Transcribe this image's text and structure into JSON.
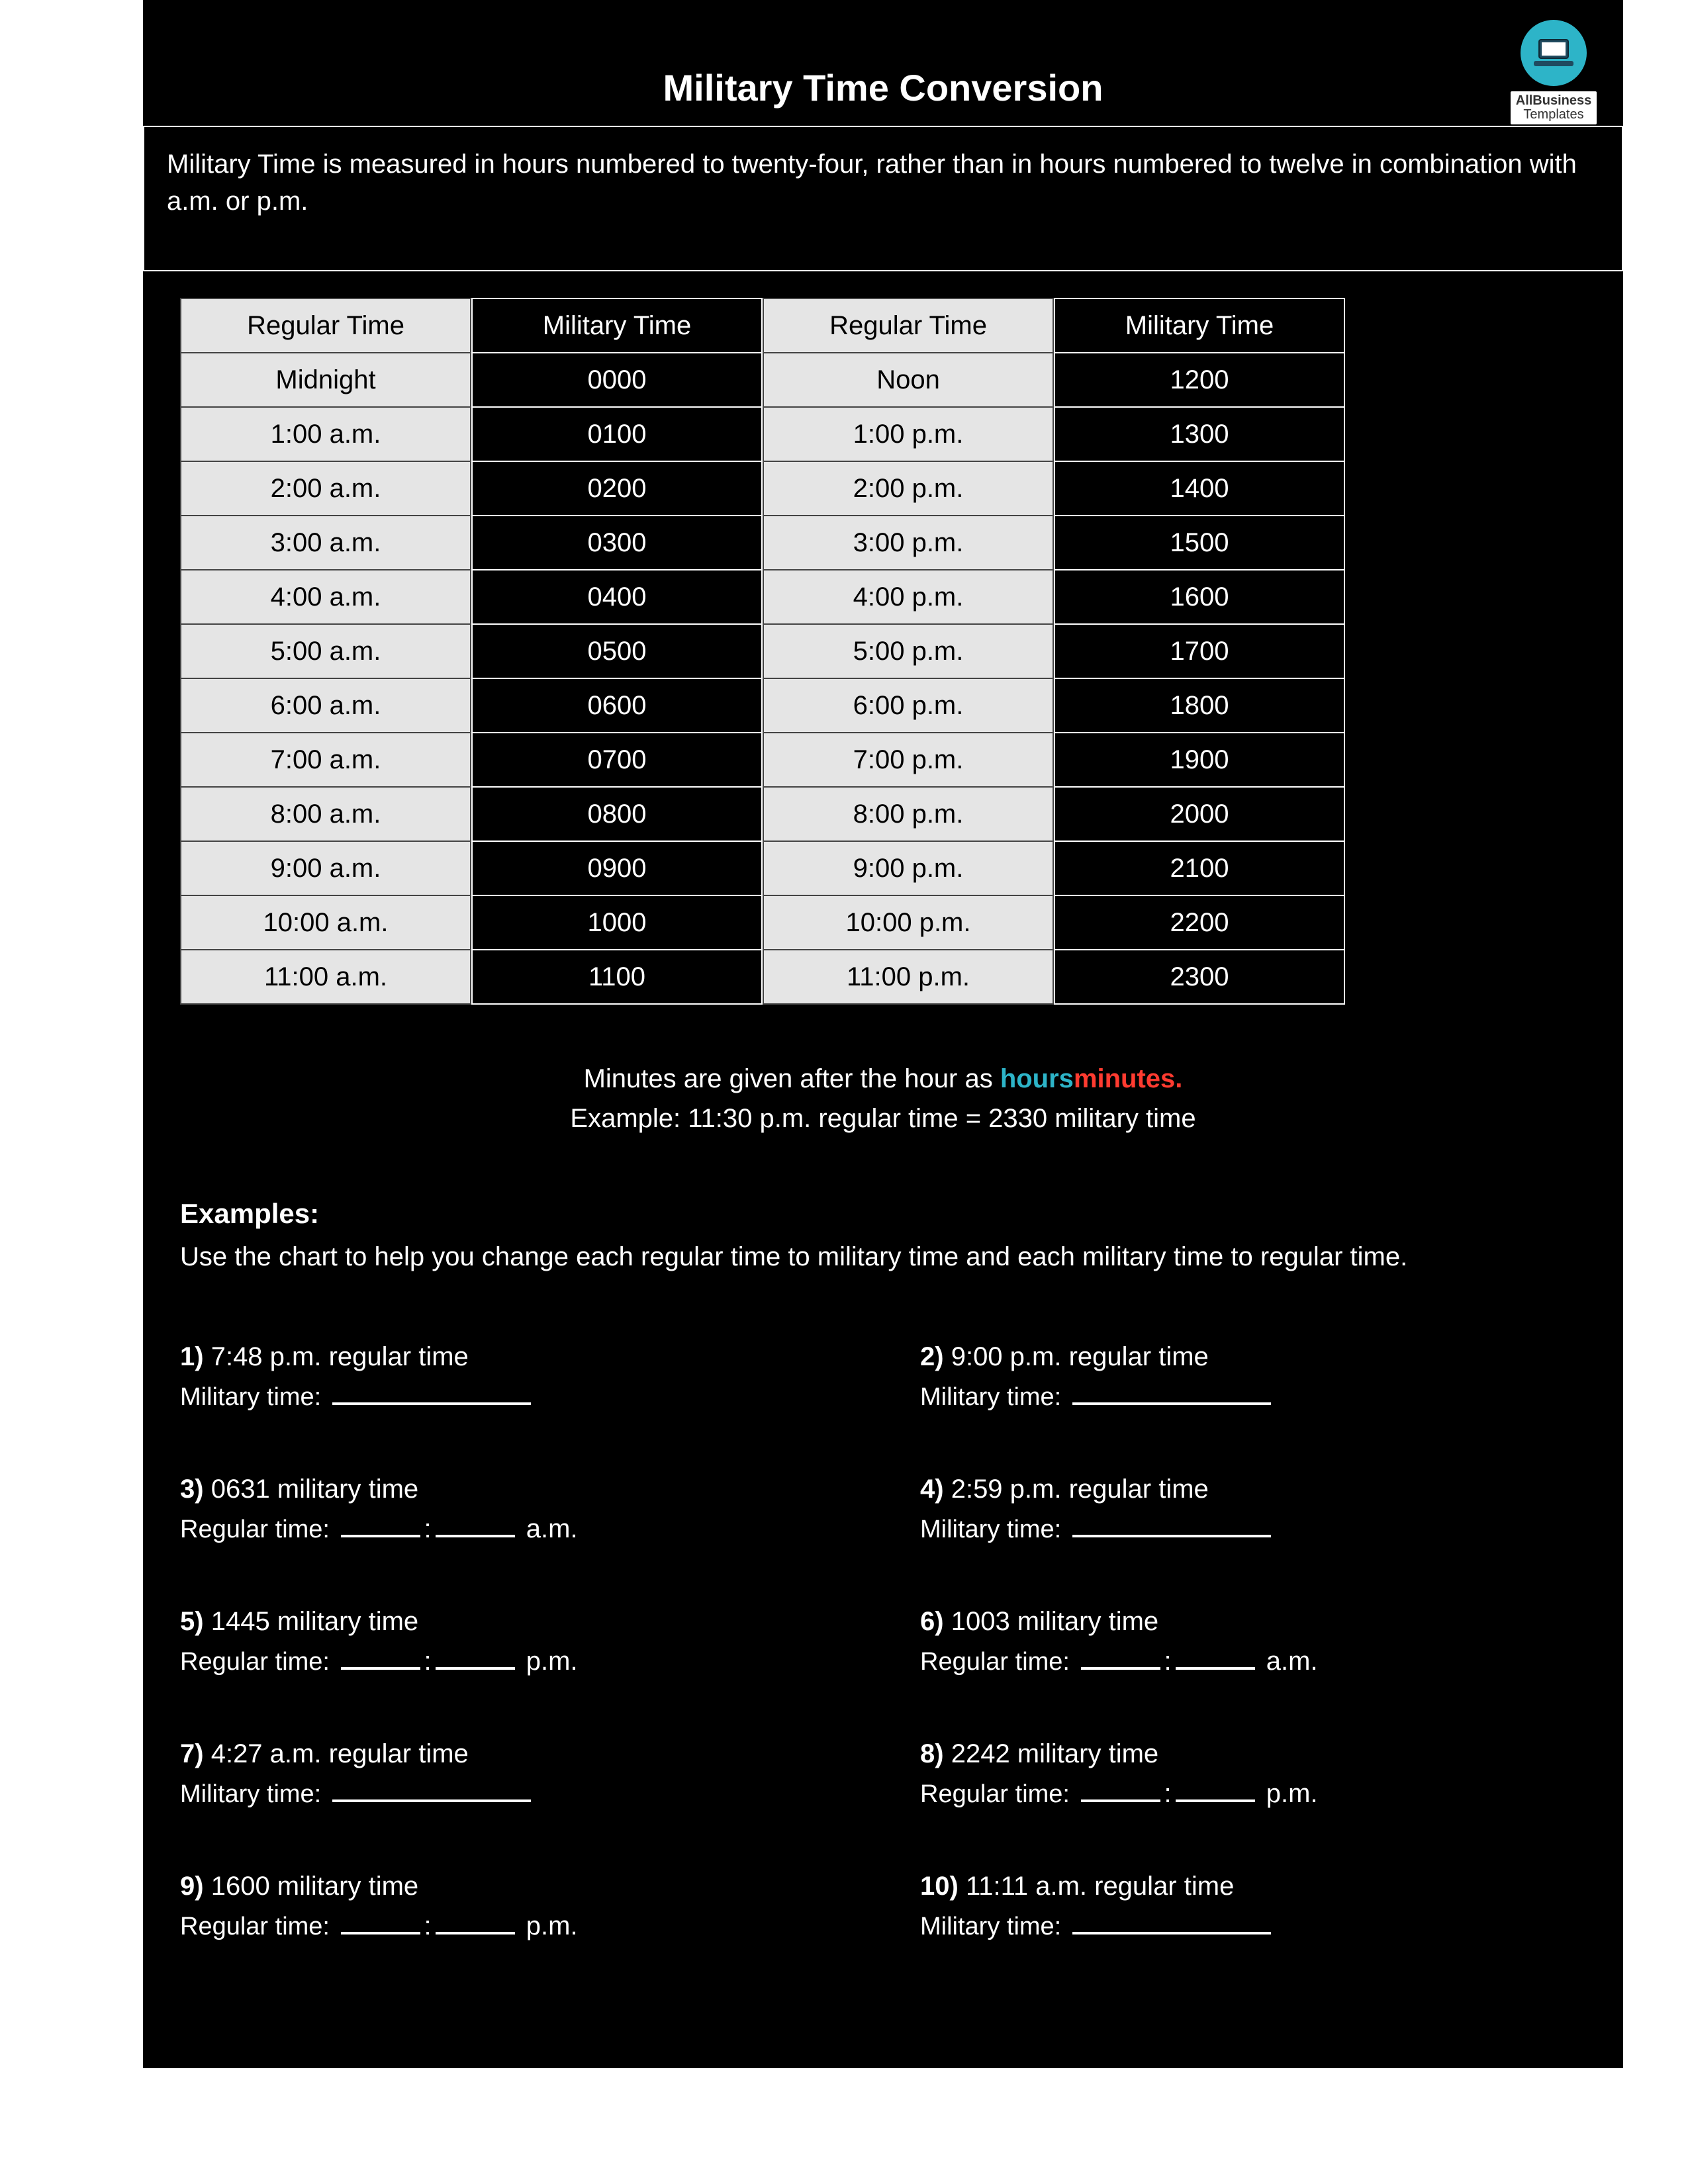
{
  "badge": {
    "line1": "AllBusiness",
    "line2": "Templates"
  },
  "title": "Military Time Conversion",
  "intro": "Military Time is measured in hours numbered to twenty-four, rather than in hours numbered to twelve in combination with a.m. or p.m.",
  "tables": {
    "left": {
      "regular_header": "Regular Time",
      "military_header": "Military Time",
      "rows": [
        {
          "reg": "Midnight",
          "mil": "0000"
        },
        {
          "reg": "1:00 a.m.",
          "mil": "0100"
        },
        {
          "reg": "2:00 a.m.",
          "mil": "0200"
        },
        {
          "reg": "3:00 a.m.",
          "mil": "0300"
        },
        {
          "reg": "4:00 a.m.",
          "mil": "0400"
        },
        {
          "reg": "5:00 a.m.",
          "mil": "0500"
        },
        {
          "reg": "6:00 a.m.",
          "mil": "0600"
        },
        {
          "reg": "7:00 a.m.",
          "mil": "0700"
        },
        {
          "reg": "8:00 a.m.",
          "mil": "0800"
        },
        {
          "reg": "9:00 a.m.",
          "mil": "0900"
        },
        {
          "reg": "10:00 a.m.",
          "mil": "1000"
        },
        {
          "reg": "11:00 a.m.",
          "mil": "1100"
        }
      ]
    },
    "right": {
      "regular_header": "Regular Time",
      "military_header": "Military Time",
      "rows": [
        {
          "reg": "Noon",
          "mil": "1200"
        },
        {
          "reg": "1:00 p.m.",
          "mil": "1300"
        },
        {
          "reg": "2:00 p.m.",
          "mil": "1400"
        },
        {
          "reg": "3:00 p.m.",
          "mil": "1500"
        },
        {
          "reg": "4:00 p.m.",
          "mil": "1600"
        },
        {
          "reg": "5:00 p.m.",
          "mil": "1700"
        },
        {
          "reg": "6:00 p.m.",
          "mil": "1800"
        },
        {
          "reg": "7:00 p.m.",
          "mil": "1900"
        },
        {
          "reg": "8:00 p.m.",
          "mil": "2000"
        },
        {
          "reg": "9:00 p.m.",
          "mil": "2100"
        },
        {
          "reg": "10:00 p.m.",
          "mil": "2200"
        },
        {
          "reg": "11:00 p.m.",
          "mil": "2300"
        }
      ]
    }
  },
  "note": {
    "line1_prefix": "Minutes are given after the hour as ",
    "hours_word": "hours",
    "minutes_word": "minutes.",
    "line2": "Example: 11:30 p.m. regular time = 2330 military time"
  },
  "examples": {
    "heading": "Examples:",
    "sub": "Use the chart to help you change each regular time to military time and each military time to regular time.",
    "items": [
      {
        "n": "1)",
        "q": "7:48 p.m. regular time",
        "answer_prefix": "Military time: "
      },
      {
        "n": "2)",
        "q": "9:00 p.m. regular time",
        "answer_prefix": "Military time: "
      },
      {
        "n": "3)",
        "q": "0631 military time",
        "answer_prefix": "Regular time: ",
        "suffix": "a.m."
      },
      {
        "n": "4)",
        "q": "2:59 p.m. regular time",
        "answer_prefix": "Military time: "
      },
      {
        "n": "5)",
        "q": "1445 military time",
        "answer_prefix": "Regular time: ",
        "suffix": "p.m."
      },
      {
        "n": "6)",
        "q": "1003 military time",
        "answer_prefix": "Regular time: ",
        "suffix": "a.m."
      },
      {
        "n": "7)",
        "q": "4:27 a.m. regular time",
        "answer_prefix": "Military time: "
      },
      {
        "n": "8)",
        "q": "2242 military time",
        "answer_prefix": "Regular time: ",
        "suffix": "p.m."
      },
      {
        "n": "9)",
        "q": "1600 military time",
        "answer_prefix": "Regular time: ",
        "suffix": "p.m."
      },
      {
        "n": "10)",
        "q": "11:11 a.m. regular time",
        "answer_prefix": "Military time: "
      }
    ]
  }
}
